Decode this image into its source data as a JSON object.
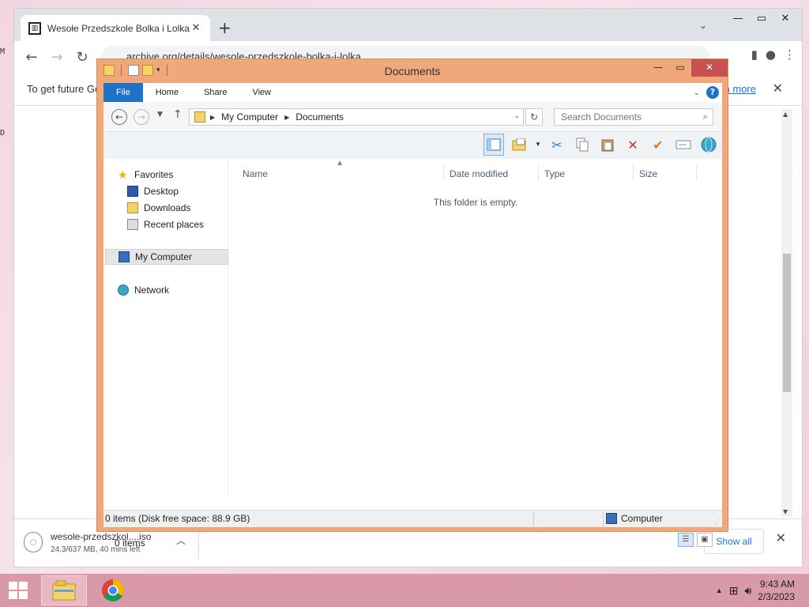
{
  "desktop": {
    "edge_labels": [
      "M",
      "D"
    ]
  },
  "chrome": {
    "tab_title": "Wesołe Przedszkole Bolka i Lolka",
    "tab_favicon": "bank-icon",
    "new_tab": "+",
    "address": "archive.org/details/wesole-przedszkole-bolka-i-lolka",
    "infobar_text": "To get future Go",
    "infobar_link": "n more",
    "download": {
      "filename": "wesole-przedszkol....iso",
      "status": "24.3/637 MB, 40 mins left"
    },
    "show_all": "Show all"
  },
  "explorer": {
    "title": "Documents",
    "ribbon_tabs": [
      "File",
      "Home",
      "Share",
      "View"
    ],
    "breadcrumb": [
      "My Computer",
      "Documents"
    ],
    "search_placeholder": "Search Documents",
    "nav": {
      "favorites": "Favorites",
      "desktop": "Desktop",
      "downloads": "Downloads",
      "recent": "Recent places",
      "my_computer": "My Computer",
      "network": "Network"
    },
    "columns": [
      "Name",
      "Date modified",
      "Type",
      "Size"
    ],
    "empty_message": "This folder is empty.",
    "items_count": "0 items",
    "status_text": "0 items (Disk free space: 88.9 GB)",
    "status_location": "Computer"
  },
  "taskbar": {
    "time": "9:43 AM",
    "date": "2/3/2023"
  },
  "colors": {
    "explorer_frame": "#f0a77a",
    "close_button": "#c75050",
    "ribbon_file": "#1e71c8",
    "taskbar": "#d89aa8"
  }
}
